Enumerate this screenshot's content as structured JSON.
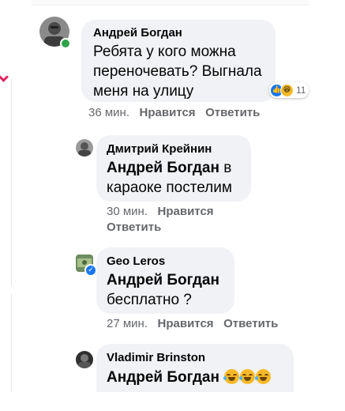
{
  "comments": [
    {
      "author": "Андрей Богдан",
      "text": "Ребята у кого можна переночевать? Выгнала меня на улицу",
      "time": "36 мин.",
      "like_label": "Нравится",
      "reply_label": "Ответить",
      "reaction_count": "11",
      "avatar_color": "#7a7a7a"
    },
    {
      "author": "Дмитрий Крейнин",
      "mention": "Андрей Богдан",
      "text": "в караоке постелим",
      "time": "30 мин.",
      "like_label": "Нравится",
      "reply_label": "Ответить",
      "avatar_color": "#6d6d6d"
    },
    {
      "author": "Geo Leros",
      "mention": "Андрей Богдан",
      "text": "бесплатно ?",
      "time": "27 мин.",
      "like_label": "Нравится",
      "reply_label": "Ответить",
      "avatar_color": "#5c7a5a"
    },
    {
      "author": "Vladimir Brinston",
      "mention": "Андрей Богдан",
      "avatar_color": "#3a3a3a"
    }
  ],
  "colors": {
    "bubble": "#f0f2f5",
    "secondary_text": "#65676b",
    "online": "#31a24c",
    "like_blue": "#1877f2"
  },
  "icons": {
    "reaction_like": "like-reaction-icon",
    "reaction_haha": "haha-reaction-icon",
    "emoji": "laughing-tears-emoji-icon"
  }
}
